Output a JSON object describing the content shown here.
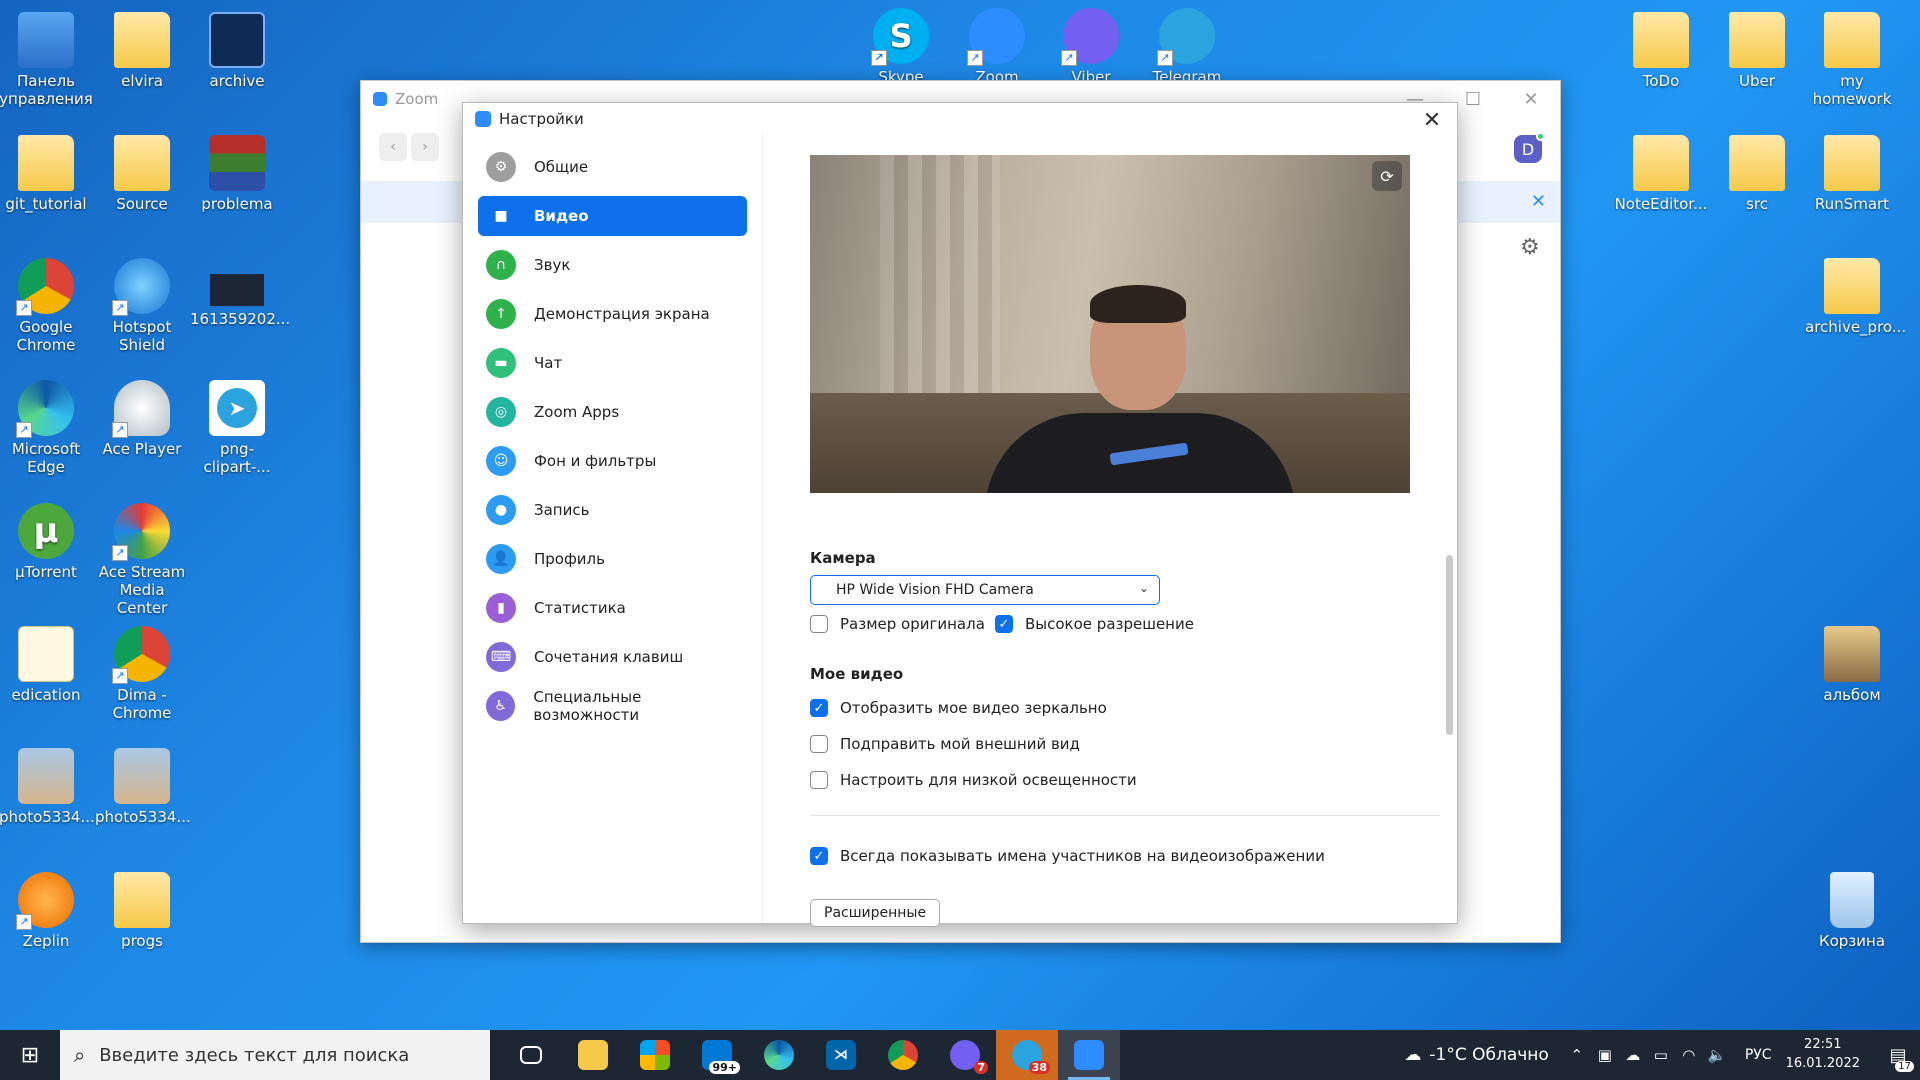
{
  "desktop_icons": {
    "control_panel": "Панель управления",
    "elvira": "elvira",
    "archive": "archive",
    "git_tutorial": "git_tutorial",
    "source": "Source",
    "problema": "problema",
    "google_chrome": "Google Chrome",
    "hotspot_shield": "Hotspot Shield",
    "file_161": "161359202...",
    "microsoft_edge": "Microsoft Edge",
    "ace_player": "Ace Player",
    "png_clipart": "png-clipart-...",
    "utorrent": "µTorrent",
    "ace_stream": "Ace Stream Media Center",
    "edication": "edication",
    "dima_chrome": "Dima - Chrome",
    "photo1": "photo5334...",
    "photo2": "photo5334...",
    "zeplin": "Zeplin",
    "progs": "progs",
    "skype": "Skype",
    "zoom": "Zoom",
    "viber": "Viber",
    "telegram": "Telegram",
    "todo": "ToDo",
    "uber": "Uber",
    "my_homework": "my homework",
    "noteeditor": "NoteEditor...",
    "src": "src",
    "runsmart": "RunSmart",
    "archive_pro": "archive_pro...",
    "album": "альбом",
    "recycle": "Корзина"
  },
  "zoom_main": {
    "title": "Zoom",
    "avatar_letter": "D"
  },
  "settings": {
    "title": "Настройки",
    "sidebar": [
      {
        "label": "Общие",
        "icon": "gear-icon",
        "color": "#9e9e9e"
      },
      {
        "label": "Видео",
        "icon": "video-icon",
        "color": "#0e71eb"
      },
      {
        "label": "Звук",
        "icon": "headphones-icon",
        "color": "#2fb14c"
      },
      {
        "label": "Демонстрация экрана",
        "icon": "share-screen-icon",
        "color": "#2fb14c"
      },
      {
        "label": "Чат",
        "icon": "chat-icon",
        "color": "#2fc07c"
      },
      {
        "label": "Zoom Apps",
        "icon": "apps-icon",
        "color": "#24b5a0"
      },
      {
        "label": "Фон и фильтры",
        "icon": "background-icon",
        "color": "#2b9cf2"
      },
      {
        "label": "Запись",
        "icon": "record-icon",
        "color": "#2b9cf2"
      },
      {
        "label": "Профиль",
        "icon": "profile-icon",
        "color": "#2b9cf2"
      },
      {
        "label": "Статистика",
        "icon": "stats-icon",
        "color": "#9a5fd6"
      },
      {
        "label": "Сочетания клавиш",
        "icon": "keyboard-icon",
        "color": "#7f6ad8"
      },
      {
        "label": "Специальные возможности",
        "icon": "accessibility-icon",
        "color": "#7f6ad8"
      }
    ],
    "camera_label": "Камера",
    "camera_value": "HP Wide Vision FHD Camera",
    "original_size": "Размер оригинала",
    "hd": "Высокое разрешение",
    "my_video_label": "Мое видео",
    "mirror": "Отобразить мое видео зеркально",
    "touch_up": "Подправить мой внешний вид",
    "low_light": "Настроить для низкой освещенности",
    "always_show_names": "Всегда показывать имена участников на видеоизображении",
    "advanced_button": "Расширенные"
  },
  "taskbar": {
    "search_placeholder": "Введите здесь текст для поиска",
    "mail_badge": "99+",
    "viber_badge": "7",
    "telegram_badge": "38",
    "weather": "-1°C Облачно",
    "lang": "РУС",
    "time": "22:51",
    "date": "16.01.2022",
    "notifications": "17"
  }
}
